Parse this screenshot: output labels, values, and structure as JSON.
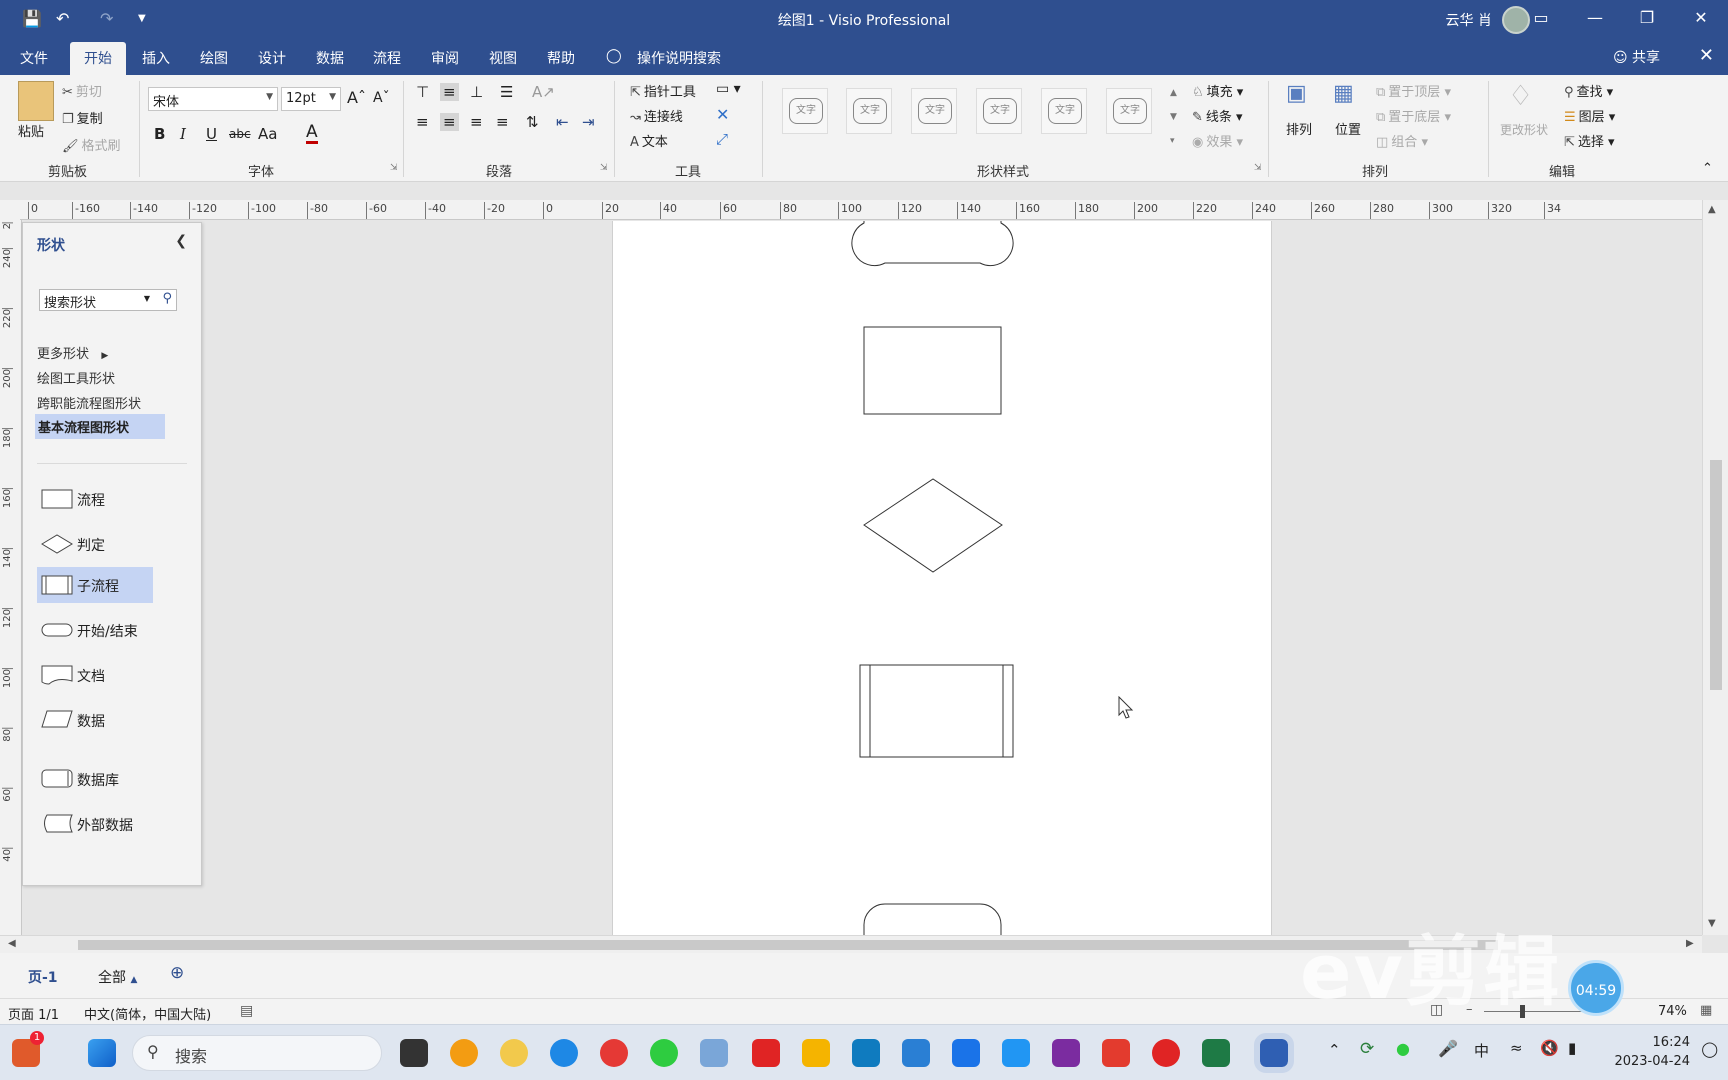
{
  "window": {
    "title": "绘图1  -  Visio Professional",
    "user": "云华 肖"
  },
  "menu": {
    "tabs": [
      "文件",
      "开始",
      "插入",
      "绘图",
      "设计",
      "数据",
      "流程",
      "审阅",
      "视图",
      "帮助"
    ],
    "tell_me": "操作说明搜索",
    "share": "共享"
  },
  "ribbon": {
    "clipboard": {
      "paste": "粘贴",
      "cut": "剪切",
      "copy": "复制",
      "format_painter": "格式刷",
      "label": "剪贴板"
    },
    "font": {
      "name": "宋体",
      "size": "12pt",
      "label": "字体",
      "bold": "B",
      "italic": "I",
      "underline": "U",
      "strike": "abc",
      "case": "Aa",
      "color": "A"
    },
    "paragraph": {
      "label": "段落"
    },
    "tools": {
      "pointer": "指针工具",
      "connector": "连接线",
      "text": "文本",
      "label": "工具"
    },
    "shape_styles": {
      "sample": "文字",
      "fill": "填充",
      "line": "线条",
      "effects": "效果",
      "label": "形状样式"
    },
    "arrange": {
      "arrange": "排列",
      "position": "位置",
      "bring_front": "置于顶层",
      "send_back": "置于底层",
      "group": "组合",
      "label": "排列"
    },
    "editing": {
      "change_shape": "更改形状",
      "find": "查找",
      "layers": "图层",
      "select": "选择",
      "label": "编辑"
    }
  },
  "rulers": {
    "h_ticks": [
      "0",
      "-160",
      "-140",
      "-120",
      "-100",
      "-80",
      "-60",
      "-40",
      "-20",
      "0",
      "20",
      "40",
      "60",
      "80",
      "100",
      "120",
      "140",
      "160",
      "180",
      "200",
      "220",
      "240",
      "260",
      "280",
      "300",
      "320",
      "34"
    ],
    "v_ticks": [
      "2",
      "240",
      "220",
      "200",
      "180",
      "160",
      "140",
      "120",
      "100",
      "80",
      "60",
      "40"
    ]
  },
  "shapes_pane": {
    "title": "形状",
    "search_placeholder": "搜索形状",
    "categories": [
      "更多形状",
      "绘图工具形状",
      "跨职能流程图形状",
      "基本流程图形状"
    ],
    "stencils": [
      "流程",
      "判定",
      "子流程",
      "开始/结束",
      "文档",
      "数据",
      "数据库",
      "外部数据"
    ]
  },
  "page_tabs": {
    "page1": "页-1",
    "all": "全部"
  },
  "status": {
    "page": "页面 1/1",
    "language": "中文(简体，中国大陆)",
    "zoom": "74%"
  },
  "taskbar": {
    "search": "搜索",
    "time": "16:24",
    "date": "2023-04-24",
    "ime": "中"
  },
  "overlay": {
    "watermark": "ev剪辑",
    "timer": "04:59"
  }
}
